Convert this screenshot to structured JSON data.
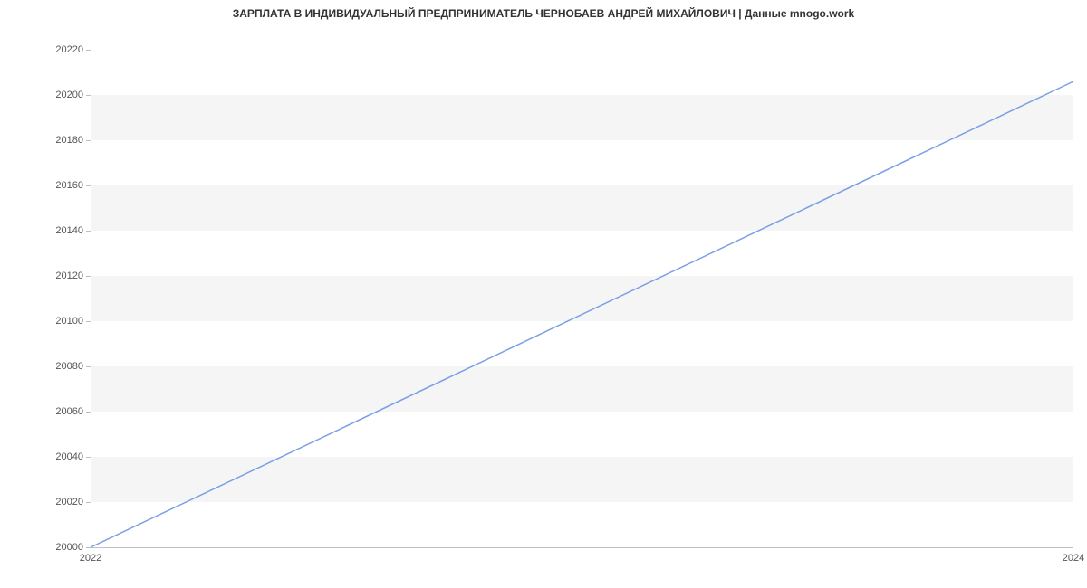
{
  "chart_data": {
    "type": "line",
    "title": "ЗАРПЛАТА В ИНДИВИДУАЛЬНЫЙ ПРЕДПРИНИМАТЕЛЬ ЧЕРНОБАЕВ АНДРЕЙ МИХАЙЛОВИЧ | Данные mnogo.work",
    "x": [
      2022,
      2024
    ],
    "values": [
      20000,
      20206
    ],
    "x_ticks": [
      2022,
      2024
    ],
    "y_ticks": [
      20000,
      20020,
      20040,
      20060,
      20080,
      20100,
      20120,
      20140,
      20160,
      20180,
      20200,
      20220
    ],
    "xlim": [
      2022,
      2024
    ],
    "ylim": [
      20000,
      20220
    ],
    "xlabel": "",
    "ylabel": "",
    "line_color": "#7a9fe6"
  }
}
